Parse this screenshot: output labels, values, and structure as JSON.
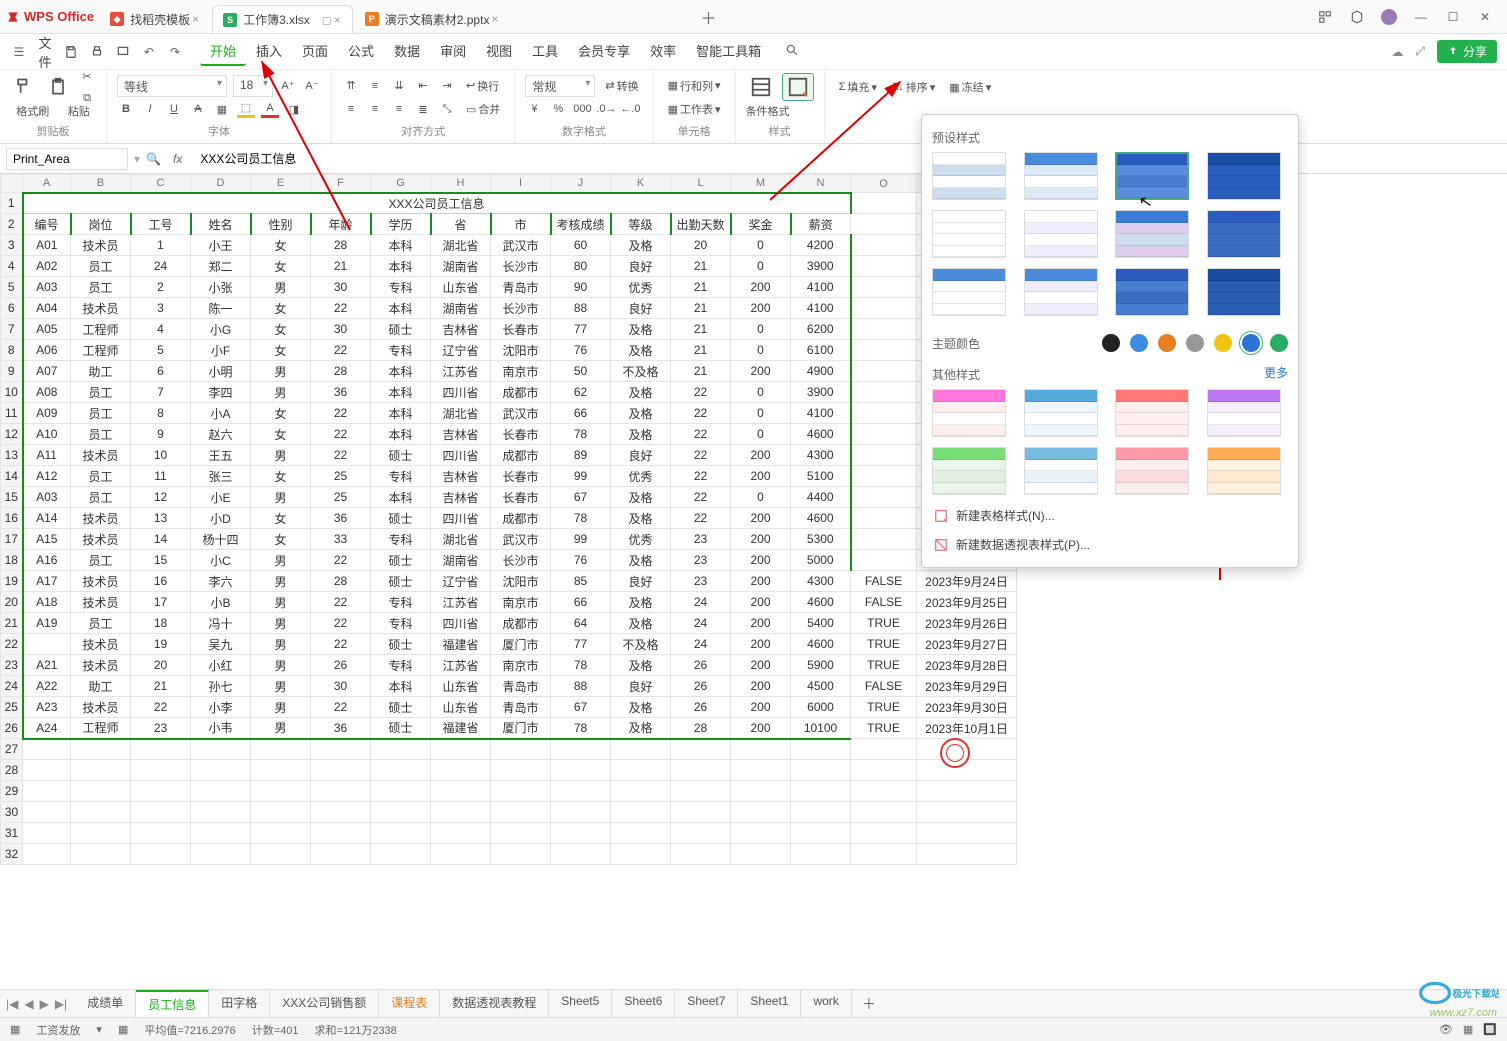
{
  "app_name": "WPS Office",
  "tabs": [
    {
      "label": "找稻壳模板",
      "icon": "red"
    },
    {
      "label": "工作簿3.xlsx",
      "icon": "green",
      "active": true
    },
    {
      "label": "演示文稿素材2.pptx",
      "icon": "orange"
    }
  ],
  "menu_file": "文件",
  "menus": [
    "开始",
    "插入",
    "页面",
    "公式",
    "数据",
    "审阅",
    "视图",
    "工具",
    "会员专享",
    "效率",
    "智能工具箱"
  ],
  "menu_active": "开始",
  "share_label": "分享",
  "ribbon": {
    "format_painter": "格式刷",
    "paste": "粘贴",
    "clipboard_label": "剪贴板",
    "font_name": "等线",
    "font_size": "18",
    "font_group_label": "字体",
    "wrap": "换行",
    "merge": "合并",
    "align_label": "对齐方式",
    "number_format": "常规",
    "convert": "转换",
    "number_label": "数字格式",
    "rows_cols": "行和列",
    "worksheet": "工作表",
    "cells_label": "单元格",
    "cond_format": "条件格式",
    "style_label": "样式",
    "fill": "填充",
    "sort": "排序",
    "freeze": "冻结"
  },
  "namebox_value": "Print_Area",
  "formula_value": "XXX公司员工信息",
  "columns": [
    "A",
    "B",
    "C",
    "D",
    "E",
    "F",
    "G",
    "H",
    "I",
    "J",
    "K",
    "L",
    "M",
    "N"
  ],
  "sheet_title": "XXX公司员工信息",
  "headers": [
    "编号",
    "岗位",
    "工号",
    "姓名",
    "性别",
    "年龄",
    "学历",
    "省",
    "市",
    "考核成绩",
    "等级",
    "出勤天数",
    "奖金",
    "薪资"
  ],
  "rows": [
    [
      "A01",
      "技术员",
      "1",
      "小王",
      "女",
      "28",
      "本科",
      "湖北省",
      "武汉市",
      "60",
      "及格",
      "20",
      "0",
      "4200"
    ],
    [
      "A02",
      "员工",
      "24",
      "郑二",
      "女",
      "21",
      "本科",
      "湖南省",
      "长沙市",
      "80",
      "良好",
      "21",
      "0",
      "3900"
    ],
    [
      "A03",
      "员工",
      "2",
      "小张",
      "男",
      "30",
      "专科",
      "山东省",
      "青岛市",
      "90",
      "优秀",
      "21",
      "200",
      "4100"
    ],
    [
      "A04",
      "技术员",
      "3",
      "陈一",
      "女",
      "22",
      "本科",
      "湖南省",
      "长沙市",
      "88",
      "良好",
      "21",
      "200",
      "4100"
    ],
    [
      "A05",
      "工程师",
      "4",
      "小G",
      "女",
      "30",
      "硕士",
      "吉林省",
      "长春市",
      "77",
      "及格",
      "21",
      "0",
      "6200"
    ],
    [
      "A06",
      "工程师",
      "5",
      "小F",
      "女",
      "22",
      "专科",
      "辽宁省",
      "沈阳市",
      "76",
      "及格",
      "21",
      "0",
      "6100"
    ],
    [
      "A07",
      "助工",
      "6",
      "小明",
      "男",
      "28",
      "本科",
      "江苏省",
      "南京市",
      "50",
      "不及格",
      "21",
      "200",
      "4900"
    ],
    [
      "A08",
      "员工",
      "7",
      "李四",
      "男",
      "36",
      "本科",
      "四川省",
      "成都市",
      "62",
      "及格",
      "22",
      "0",
      "3900"
    ],
    [
      "A09",
      "员工",
      "8",
      "小A",
      "女",
      "22",
      "本科",
      "湖北省",
      "武汉市",
      "66",
      "及格",
      "22",
      "0",
      "4100"
    ],
    [
      "A10",
      "员工",
      "9",
      "赵六",
      "女",
      "22",
      "本科",
      "吉林省",
      "长春市",
      "78",
      "及格",
      "22",
      "0",
      "4600"
    ],
    [
      "A11",
      "技术员",
      "10",
      "王五",
      "男",
      "22",
      "硕士",
      "四川省",
      "成都市",
      "89",
      "良好",
      "22",
      "200",
      "4300"
    ],
    [
      "A12",
      "员工",
      "11",
      "张三",
      "女",
      "25",
      "专科",
      "吉林省",
      "长春市",
      "99",
      "优秀",
      "22",
      "200",
      "5100"
    ],
    [
      "A03",
      "员工",
      "12",
      "小E",
      "男",
      "25",
      "本科",
      "吉林省",
      "长春市",
      "67",
      "及格",
      "22",
      "0",
      "4400"
    ],
    [
      "A14",
      "技术员",
      "13",
      "小D",
      "女",
      "36",
      "硕士",
      "四川省",
      "成都市",
      "78",
      "及格",
      "22",
      "200",
      "4600"
    ],
    [
      "A15",
      "技术员",
      "14",
      "杨十四",
      "女",
      "33",
      "专科",
      "湖北省",
      "武汉市",
      "99",
      "优秀",
      "23",
      "200",
      "5300"
    ],
    [
      "A16",
      "员工",
      "15",
      "小C",
      "男",
      "22",
      "硕士",
      "湖南省",
      "长沙市",
      "76",
      "及格",
      "23",
      "200",
      "5000"
    ],
    [
      "A17",
      "技术员",
      "16",
      "李六",
      "男",
      "28",
      "硕士",
      "辽宁省",
      "沈阳市",
      "85",
      "良好",
      "23",
      "200",
      "4300",
      "FALSE",
      "2023年9月24日"
    ],
    [
      "A18",
      "技术员",
      "17",
      "小B",
      "男",
      "22",
      "专科",
      "江苏省",
      "南京市",
      "66",
      "及格",
      "24",
      "200",
      "4600",
      "FALSE",
      "2023年9月25日"
    ],
    [
      "A19",
      "员工",
      "18",
      "冯十",
      "男",
      "22",
      "专科",
      "四川省",
      "成都市",
      "64",
      "及格",
      "24",
      "200",
      "5400",
      "TRUE",
      "2023年9月26日"
    ],
    [
      "",
      "技术员",
      "19",
      "吴九",
      "男",
      "22",
      "硕士",
      "福建省",
      "厦门市",
      "77",
      "不及格",
      "24",
      "200",
      "4600",
      "TRUE",
      "2023年9月27日"
    ],
    [
      "A21",
      "技术员",
      "20",
      "小红",
      "男",
      "26",
      "专科",
      "江苏省",
      "南京市",
      "78",
      "及格",
      "26",
      "200",
      "5900",
      "TRUE",
      "2023年9月28日"
    ],
    [
      "A22",
      "助工",
      "21",
      "孙七",
      "男",
      "30",
      "本科",
      "山东省",
      "青岛市",
      "88",
      "良好",
      "26",
      "200",
      "4500",
      "FALSE",
      "2023年9月29日"
    ],
    [
      "A23",
      "技术员",
      "22",
      "小李",
      "男",
      "22",
      "硕士",
      "山东省",
      "青岛市",
      "67",
      "及格",
      "26",
      "200",
      "6000",
      "TRUE",
      "2023年9月30日"
    ],
    [
      "A24",
      "工程师",
      "23",
      "小韦",
      "男",
      "36",
      "硕士",
      "福建省",
      "厦门市",
      "78",
      "及格",
      "28",
      "200",
      "10100",
      "TRUE",
      "2023年10月1日"
    ]
  ],
  "sheets": [
    "成绩单",
    "员工信息",
    "田字格",
    "XXX公司销售额",
    "课程表",
    "数据透视表教程",
    "Sheet5",
    "Sheet6",
    "Sheet7",
    "Sheet1",
    "work"
  ],
  "sheet_active_index": 1,
  "sheet_orange_index": 4,
  "statusbar": {
    "doc_label": "工资发放",
    "avg_label": "平均值=7216.2976",
    "count_label": "计数=401",
    "sum_label": "求和=121万2338"
  },
  "style_panel": {
    "title_preset": "预设样式",
    "theme_colors": "主题颜色",
    "title_other": "其他样式",
    "more": "更多",
    "action_tablestyle": "新建表格样式(N)...",
    "action_pivotstyle": "新建数据透视表样式(P)...",
    "swatch_colors": [
      "#222",
      "#3a8dde",
      "#e67e22",
      "#999",
      "#f1c40f",
      "#2a75d4",
      "#27ae60"
    ],
    "swatch_selected_index": 5
  },
  "watermark": {
    "site": "www.xz7.com",
    "brand": "极光下载站"
  }
}
